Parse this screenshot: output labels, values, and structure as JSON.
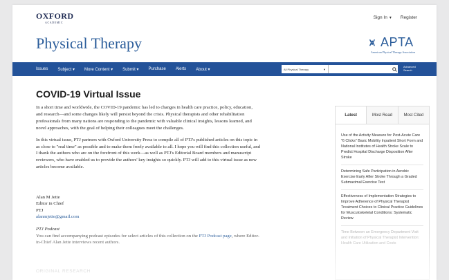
{
  "header": {
    "publisher_name": "OXFORD",
    "publisher_sub": "ACADEMIC",
    "sign_in": "Sign In",
    "register": "Register",
    "journal_title": "Physical Therapy",
    "apta_logo_text": "APTA",
    "apta_tagline": "American Physical Therapy Association"
  },
  "nav": {
    "items": [
      "Issues",
      "Subject",
      "More Content",
      "Submit",
      "Purchase",
      "Alerts",
      "About"
    ],
    "search_scope": "All Physical Therapy",
    "search_value": "",
    "advanced_search_line1": "Advanced",
    "advanced_search_line2": "Search"
  },
  "main": {
    "title": "COVID-19 Virtual Issue",
    "paragraphs": [
      "In a short time and worldwide, the COVID-19 pandemic has led to changes in health care practice, policy, education, and research—and some changes likely will persist beyond the crisis. Physical therapists and other rehabilitation professionals from many nations are responding to the pandemic with valuable clinical insights, lessons learned, and novel approaches, with the goal of helping their colleagues meet the challenges.",
      "In this virtual issue, PTJ partners with Oxford University Press to compile all of PTJ's published articles on this topic in as close to \"real time\" as possible and to make them freely available to all. I hope you will find this collection useful, and I thank the authors who are on the forefront of this work—as well as PTJ's Editorial Board members and manuscript reviewers, who have enabled us to provide the authors' key insights so quickly. PTJ will add to this virtual issue as new articles become available."
    ],
    "signature": {
      "name": "Alan M Jette",
      "role": "Editor in Chief",
      "journal": "PTJ",
      "email": "alanmjette@gmail.com"
    },
    "podcast": {
      "heading": "PTJ Podcast",
      "text_before": "You can find accompanying podcast episodes for select articles of this collection on the ",
      "link_text": "PTJ Podcast page",
      "text_after": ", where Editor-in-Chief Alan Jette interviews recent authors."
    },
    "section_heading": "ORIGINAL RESEARCH"
  },
  "sidebar": {
    "tabs": [
      "Latest",
      "Most Read",
      "Most Cited"
    ],
    "items": [
      "Use of the Activity Measure for Post-Acute Care \"6 Clicks\" Basic Mobility Inpatient Short Form and National Institutes of Health Stroke Scale to Predict Hospital Discharge Disposition After Stroke",
      "Determining Safe Participation in Aerobic Exercise Early After Stroke Through a Graded Submaximal Exercise Test",
      "Effectiveness of Implementation Strategies to Improve Adherence of Physical Therapist Treatment Choices to Clinical Practice Guidelines for Musculoskeletal Conditions: Systematic Review",
      "Time Between an Emergency Department Visit and Initiation of Physical Therapist Intervention: Health Care Utilization and Costs"
    ]
  },
  "colors": {
    "nav_bg": "#235299",
    "brand_blue": "#2a5c9a",
    "oxford_navy": "#1e2a52"
  }
}
